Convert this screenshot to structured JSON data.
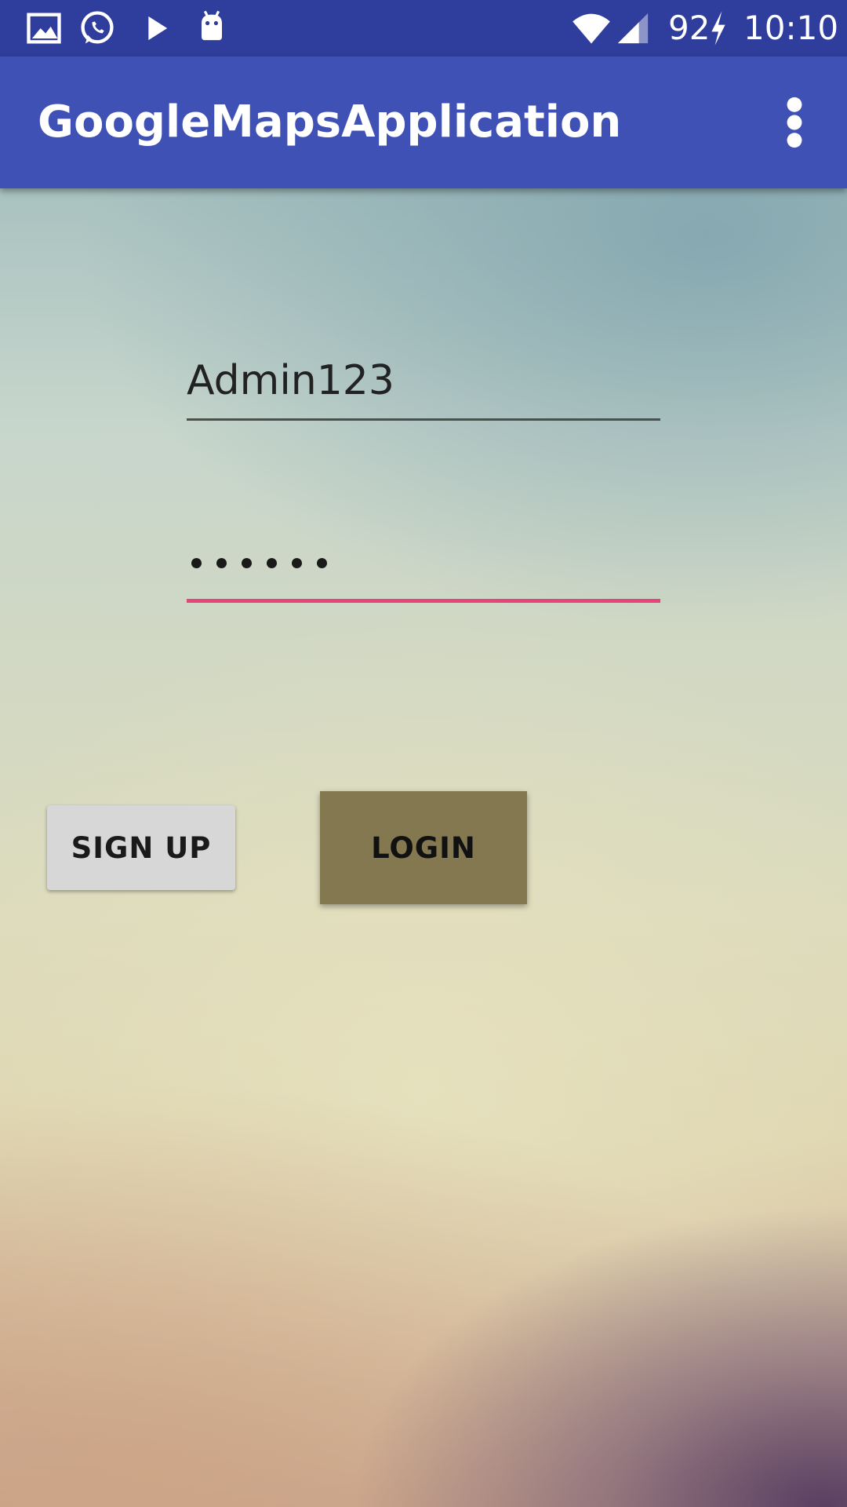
{
  "status_bar": {
    "left_icons": [
      "image-icon",
      "whatsapp-icon",
      "play-icon",
      "android-icon"
    ],
    "right_icons": [
      "wifi-icon",
      "cell-signal-icon",
      "charging-bolt-icon"
    ],
    "battery_level": "92",
    "time": "10:10"
  },
  "app_bar": {
    "title": "GoogleMapsApplication",
    "menu_icon": "more-vertical-icon"
  },
  "login_form": {
    "username_value": "Admin123",
    "password_masked": "••••••",
    "password_length": 6,
    "focused_field": "password"
  },
  "buttons": {
    "signup_label": "SIGN UP",
    "login_label": "LOGIN"
  },
  "colors": {
    "status_bar": "#2f3d9c",
    "app_bar": "#3f51b5",
    "accent_underline": "#e8447b",
    "login_button": "#83784f",
    "signup_button": "#d6d7d6"
  }
}
